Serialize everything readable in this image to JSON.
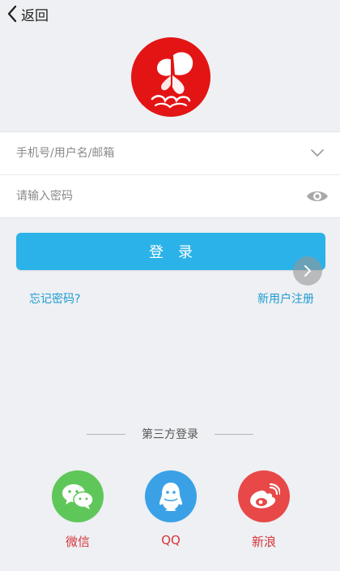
{
  "header": {
    "back_label": "返回"
  },
  "form": {
    "username_placeholder": "手机号/用户名/邮箱",
    "password_placeholder": "请输入密码"
  },
  "login_button": "登录",
  "links": {
    "forgot": "忘记密码?",
    "register": "新用户注册"
  },
  "third_party": {
    "title": "第三方登录",
    "items": [
      {
        "label": "微信",
        "icon": "wechat-icon"
      },
      {
        "label": "QQ",
        "icon": "qq-icon"
      },
      {
        "label": "新浪",
        "icon": "weibo-icon"
      }
    ]
  },
  "colors": {
    "primary": "#2bb2e8",
    "link": "#1e9bd1",
    "logo_red": "#e31414",
    "social_label": "#d6363b",
    "wechat": "#5fc75a",
    "qq": "#3ba1e6",
    "weibo": "#e84848"
  }
}
